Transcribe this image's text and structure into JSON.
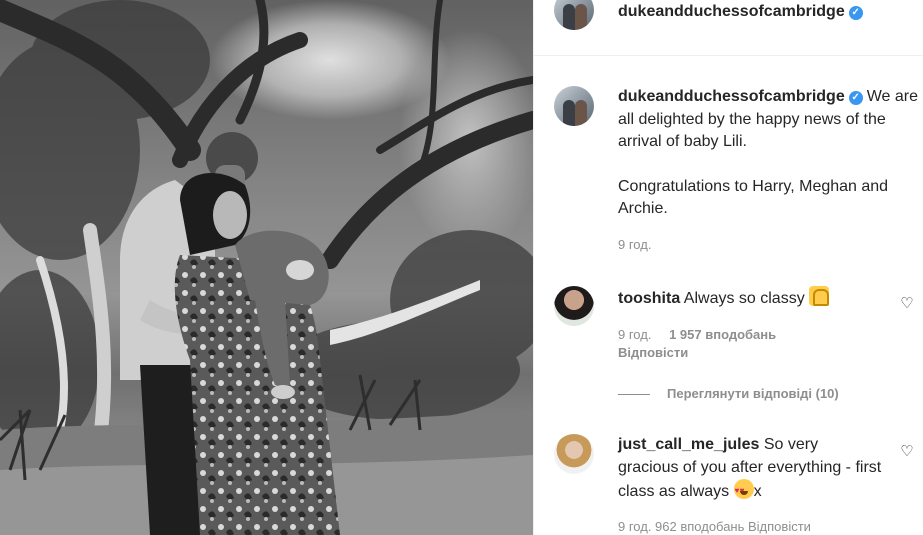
{
  "post": {
    "image_alt_semantic": "black-and-white family photo"
  },
  "header": {
    "username": "dukeandduchessofcambridge"
  },
  "caption": {
    "username": "dukeandduchessofcambridge",
    "text_line1": "We are all delighted by the happy news of the arrival of baby Lili.",
    "text_line2": "Congratulations to Harry, Meghan and Archie.",
    "time": "9 год."
  },
  "comments": [
    {
      "username": "tooshita",
      "text": "Always so classy",
      "emoji": "raising-hands-emoji",
      "time": "9 год.",
      "likes": "1 957 вподобань",
      "reply": "Відповісти"
    },
    {
      "username": "just_call_me_jules",
      "text": "So very gracious of you after everything - first class as always",
      "emoji": "heart-eyes-emoji",
      "suffix": "x",
      "partial_meta": "9 год.   962 вподобань   Відповісти"
    }
  ],
  "view_replies": "Переглянути відповіді (10)",
  "icons": {
    "verified": "verified-badge-icon",
    "like": "heart-outline-icon"
  },
  "colors": {
    "verified": "#3897f0",
    "secondary_text": "#8e8e8e",
    "primary_text": "#262626"
  }
}
